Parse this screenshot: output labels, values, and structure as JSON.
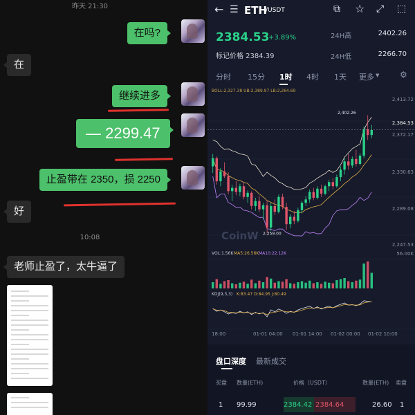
{
  "chat": {
    "timestamp_top": "昨天 21:30",
    "timestamp_mid": "10:08",
    "messages": [
      {
        "side": "me",
        "text": "在吗?"
      },
      {
        "side": "other",
        "text": "在"
      },
      {
        "side": "me",
        "text": "继续进多"
      },
      {
        "side": "me",
        "text": "— 2299.47"
      },
      {
        "side": "me",
        "text": "止盈带在 2350，损 2250"
      },
      {
        "side": "other",
        "text": "好"
      },
      {
        "side": "other",
        "text": "老师止盈了，太牛逼了"
      }
    ],
    "colors": {
      "me_bubble": "#4cc06a",
      "other_bubble": "#2a2a2a",
      "annotation": "#e0322d"
    }
  },
  "trade": {
    "pair": "ETH",
    "quote": "/USDT",
    "price": "2384.53",
    "change": "+3.89%",
    "mark_price": "标记价格 2384.39",
    "high_label": "24H高",
    "high_value": "2402.26",
    "low_label": "24H低",
    "low_value": "2266.70",
    "tabs": [
      "分时",
      "15分",
      "1时",
      "4时",
      "1天",
      "更多"
    ],
    "active_tab": "1时",
    "icons": [
      "back-arrow-icon",
      "menu-icon",
      "chart-settings-icon",
      "star-icon",
      "fullscreen-icon",
      "landscape-icon"
    ],
    "boll_label": "BOLL(20,2)",
    "boll_values": "BOLL:2,327.38 UB:2,389.97 LB:2,264.69",
    "price_axis": [
      "2,413.72",
      "2,384.53",
      "2,372.17",
      "2,330.63",
      "2,289.08",
      "2,247.53"
    ],
    "chart_high_label": "2,402.26",
    "chart_low_label": "2,259.00",
    "watermark": "CoinW",
    "vol_label": "VOL:1.56K",
    "ma5_label": "MA5:26.56K",
    "ma10_label": "MA10:22.12K",
    "vol_axis": "56.00K",
    "kdj_label": "KDJ(9,3,3)",
    "kdj_values": "K:83.47 D:84.95 J:80.49",
    "x_axis": [
      "18:00",
      "01-01 04:00",
      "01-01 14:00",
      "01-02 00:00",
      "01-02 10:00"
    ],
    "orderbook": {
      "tabs": [
        "盘口深度",
        "最新成交"
      ],
      "headers": [
        "买盘",
        "数量(ETH)",
        "价格（USDT）",
        "数量(ETH)",
        "卖盘"
      ],
      "row": {
        "index_buy": "1",
        "qty_buy": "99.99",
        "price_buy": "2384.42",
        "price_sell": "2384.64",
        "qty_sell": "26.60",
        "index_sell": "1"
      }
    },
    "colors": {
      "up": "#2bd18a",
      "down": "#e0556a",
      "background": "#161a2a"
    },
    "candles": [
      [
        2340,
        2355,
        2332,
        2350
      ],
      [
        2350,
        2352,
        2318,
        2322
      ],
      [
        2322,
        2338,
        2316,
        2334
      ],
      [
        2334,
        2345,
        2326,
        2328
      ],
      [
        2328,
        2333,
        2306,
        2310
      ],
      [
        2310,
        2318,
        2298,
        2314
      ],
      [
        2314,
        2322,
        2305,
        2309
      ],
      [
        2309,
        2319,
        2304,
        2316
      ],
      [
        2316,
        2321,
        2300,
        2303
      ],
      [
        2303,
        2311,
        2296,
        2308
      ],
      [
        2308,
        2310,
        2288,
        2292
      ],
      [
        2292,
        2302,
        2286,
        2298
      ],
      [
        2298,
        2304,
        2285,
        2288
      ],
      [
        2288,
        2296,
        2276,
        2293
      ],
      [
        2293,
        2299,
        2259,
        2266
      ],
      [
        2266,
        2296,
        2262,
        2292
      ],
      [
        2292,
        2300,
        2281,
        2285
      ],
      [
        2285,
        2306,
        2283,
        2303
      ],
      [
        2303,
        2307,
        2288,
        2291
      ],
      [
        2291,
        2296,
        2263,
        2270
      ],
      [
        2270,
        2282,
        2265,
        2279
      ],
      [
        2279,
        2286,
        2270,
        2274
      ],
      [
        2274,
        2290,
        2272,
        2287
      ],
      [
        2287,
        2298,
        2283,
        2296
      ],
      [
        2296,
        2304,
        2292,
        2300
      ],
      [
        2300,
        2312,
        2296,
        2309
      ],
      [
        2309,
        2314,
        2299,
        2302
      ],
      [
        2302,
        2316,
        2300,
        2313
      ],
      [
        2313,
        2318,
        2303,
        2307
      ],
      [
        2307,
        2318,
        2305,
        2316
      ],
      [
        2316,
        2324,
        2310,
        2321
      ],
      [
        2321,
        2326,
        2312,
        2316
      ],
      [
        2316,
        2330,
        2314,
        2327
      ],
      [
        2327,
        2340,
        2322,
        2336
      ],
      [
        2336,
        2350,
        2330,
        2346
      ],
      [
        2346,
        2355,
        2336,
        2341
      ],
      [
        2341,
        2352,
        2338,
        2349
      ],
      [
        2349,
        2360,
        2340,
        2343
      ],
      [
        2343,
        2356,
        2341,
        2353
      ],
      [
        2353,
        2388,
        2350,
        2385
      ],
      [
        2385,
        2402,
        2372,
        2378
      ],
      [
        2378,
        2390,
        2374,
        2384
      ]
    ],
    "volumes": [
      12,
      18,
      9,
      14,
      16,
      10,
      8,
      11,
      13,
      9,
      17,
      10,
      15,
      12,
      22,
      19,
      11,
      14,
      13,
      18,
      10,
      9,
      12,
      14,
      11,
      15,
      10,
      12,
      9,
      13,
      11,
      10,
      16,
      18,
      20,
      14,
      12,
      15,
      17,
      48,
      52,
      30
    ],
    "kdj_k": [
      60,
      50,
      55,
      48,
      40,
      45,
      42,
      50,
      44,
      48,
      38,
      46,
      40,
      45,
      30,
      55,
      48,
      58,
      52,
      42,
      50,
      46,
      55,
      60,
      64,
      68,
      60,
      66,
      58,
      64,
      68,
      62,
      70,
      75,
      80,
      72,
      74,
      70,
      76,
      88,
      86,
      84
    ],
    "kdj_d": [
      58,
      54,
      54,
      52,
      46,
      46,
      44,
      47,
      45,
      46,
      42,
      44,
      42,
      43,
      38,
      45,
      46,
      50,
      51,
      48,
      48,
      47,
      50,
      54,
      58,
      62,
      61,
      63,
      61,
      62,
      64,
      63,
      66,
      70,
      74,
      73,
      73,
      72,
      73,
      80,
      83,
      85
    ]
  }
}
